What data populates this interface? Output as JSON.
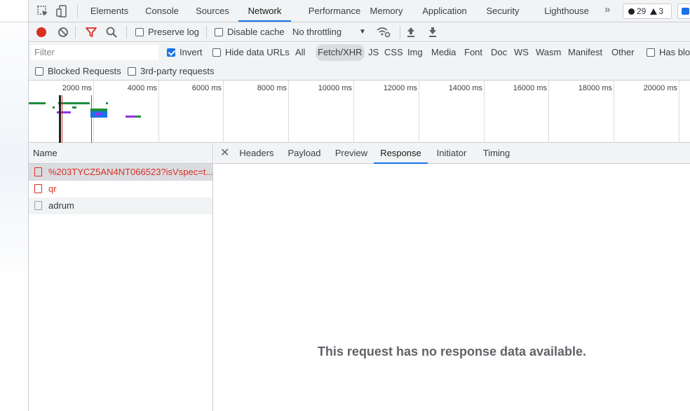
{
  "tabs": [
    "Elements",
    "Console",
    "Sources",
    "Network",
    "Performance",
    "Memory",
    "Application",
    "Security",
    "Lighthouse"
  ],
  "active_tab": "Network",
  "more_tabs_glyph": "»",
  "counts": {
    "errors": "29",
    "warnings": "3"
  },
  "toolbar": {
    "preserve_log": "Preserve log",
    "disable_cache": "Disable cache",
    "throttling": "No throttling",
    "dropdown_glyph": "▼"
  },
  "filter": {
    "placeholder": "Filter",
    "invert": "Invert",
    "hide_data_urls": "Hide data URLs",
    "types": [
      "All",
      "Fetch/XHR",
      "JS",
      "CSS",
      "Img",
      "Media",
      "Font",
      "Doc",
      "WS",
      "Wasm",
      "Manifest",
      "Other"
    ],
    "active_type": "Fetch/XHR",
    "has_blocked": "Has blo",
    "blocked_requests": "Blocked Requests",
    "third_party": "3rd-party requests"
  },
  "overview": {
    "ticks": [
      "2000 ms",
      "4000 ms",
      "6000 ms",
      "8000 ms",
      "10000 ms",
      "12000 ms",
      "14000 ms",
      "16000 ms",
      "18000 ms",
      "20000 ms"
    ]
  },
  "request_list": {
    "header": "Name",
    "rows": [
      {
        "name": "%203TYCZ5AN4NT066523?isVspec=t...",
        "error": true
      },
      {
        "name": "qr",
        "error": true
      },
      {
        "name": "adrum",
        "error": false
      }
    ]
  },
  "details": {
    "close_glyph": "✕",
    "tabs": [
      "Headers",
      "Payload",
      "Preview",
      "Response",
      "Initiator",
      "Timing"
    ],
    "active_tab": "Response",
    "empty_message": "This request has no response data available."
  },
  "colors": {
    "accent": "#1a73e8",
    "error": "#d93025",
    "record": "#d93025"
  }
}
